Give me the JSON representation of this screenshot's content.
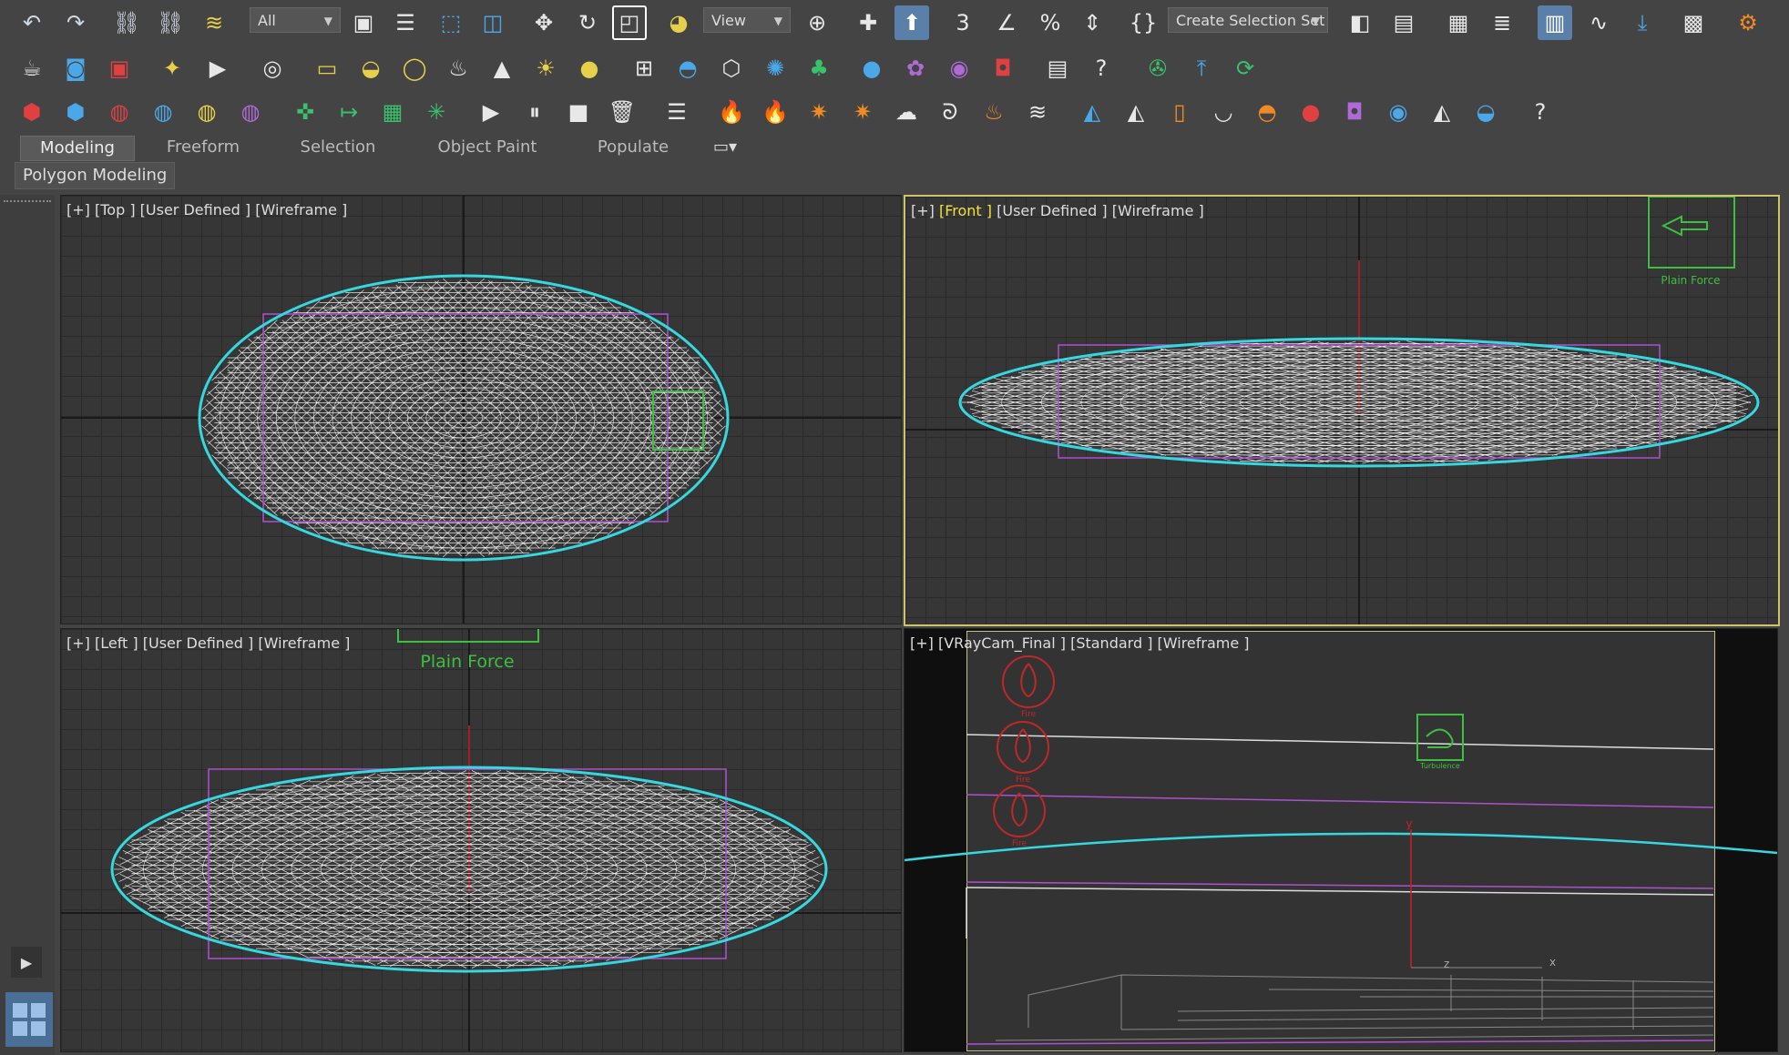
{
  "toolbar": {
    "selection_filter": "All",
    "reference_coord": "View",
    "named_selection": "Create Selection Set"
  },
  "ribbon": {
    "tabs": [
      "Modeling",
      "Freeform",
      "Selection",
      "Object Paint",
      "Populate"
    ],
    "sub_panel": "Polygon Modeling"
  },
  "viewports": {
    "top": {
      "p1": "[+]",
      "p2": "[Top ]",
      "p3": "[User Defined ]",
      "p4": "[Wireframe ]"
    },
    "front": {
      "p1": "[+]",
      "p2": "[Front ]",
      "p3": "[User Defined ]",
      "p4": "[Wireframe ]",
      "helper": "Plain Force"
    },
    "left": {
      "p1": "[+]",
      "p2": "[Left ]",
      "p3": "[User Defined ]",
      "p4": "[Wireframe ]",
      "helper": "Plain Force"
    },
    "camera": {
      "p1": "[+]",
      "p2": "[VRayCam_Final ]",
      "p3": "[Standard ]",
      "p4": "[Wireframe ]",
      "fire_label": "Fire",
      "turbulence_label": "Turbulence",
      "axis_y": "y",
      "axis_x": "x",
      "axis_z": "z"
    }
  },
  "colors": {
    "selection": "#36d8e0",
    "mesh": "#ffffff",
    "bbox": "#b050d0",
    "helper": "#3fbf3f",
    "axis_y": "#d02020"
  },
  "help_icon": "?"
}
